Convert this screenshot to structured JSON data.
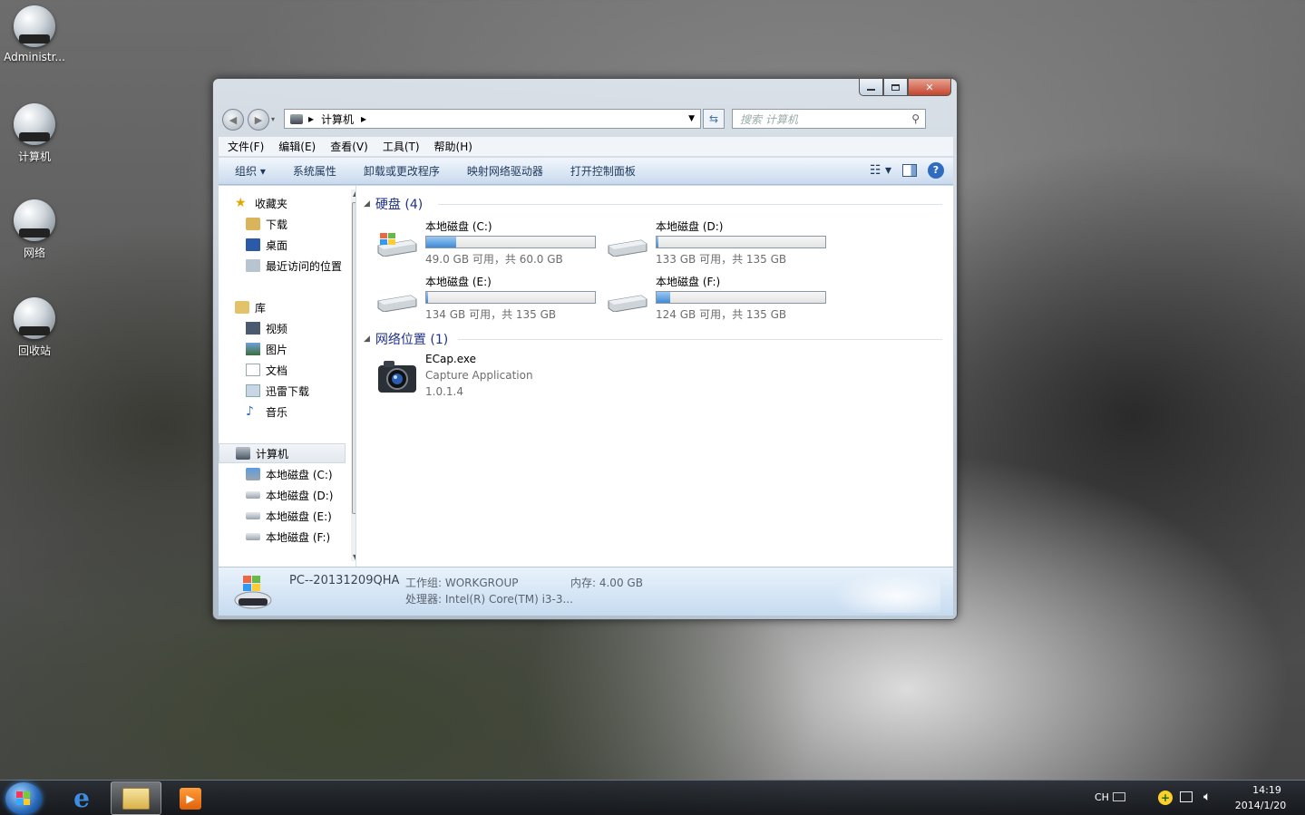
{
  "desktop": {
    "icons": [
      {
        "label": "Administr..."
      },
      {
        "label": "计算机"
      },
      {
        "label": "网络"
      },
      {
        "label": "回收站"
      }
    ]
  },
  "window": {
    "address": {
      "crumb": "计算机"
    },
    "search_placeholder": "搜索 计算机",
    "menu": [
      "文件(F)",
      "编辑(E)",
      "查看(V)",
      "工具(T)",
      "帮助(H)"
    ],
    "commands": [
      "组织 ▾",
      "系统属性",
      "卸载或更改程序",
      "映射网络驱动器",
      "打开控制面板"
    ],
    "nav": {
      "favorites": "收藏夹",
      "fav_items": [
        "下载",
        "桌面",
        "最近访问的位置"
      ],
      "libraries": "库",
      "lib_items": [
        "视频",
        "图片",
        "文档",
        "迅雷下载",
        "音乐"
      ],
      "computer": "计算机",
      "drives": [
        "本地磁盘 (C:)",
        "本地磁盘 (D:)",
        "本地磁盘 (E:)",
        "本地磁盘 (F:)"
      ]
    },
    "groups": {
      "hdd": "硬盘 (4)",
      "network": "网络位置 (1)"
    },
    "drives": [
      {
        "name": "本地磁盘 (C:)",
        "free": "49.0 GB 可用，共 60.0 GB",
        "used_fraction": 0.18
      },
      {
        "name": "本地磁盘 (D:)",
        "free": "133 GB 可用，共 135 GB",
        "used_fraction": 0.01
      },
      {
        "name": "本地磁盘 (E:)",
        "free": "134 GB 可用，共 135 GB",
        "used_fraction": 0.01
      },
      {
        "name": "本地磁盘 (F:)",
        "free": "124 GB 可用，共 135 GB",
        "used_fraction": 0.08
      }
    ],
    "network_item": {
      "name": "ECap.exe",
      "desc": "Capture Application",
      "version": "1.0.1.4"
    },
    "details": {
      "pc": "PC--20131209QHA",
      "workgroup": "工作组: WORKGROUP",
      "memory": "内存: 4.00 GB",
      "cpu": "处理器: Intel(R) Core(TM) i3-3..."
    }
  },
  "taskbar": {
    "lang": "CH",
    "time": "14:19",
    "date": "2014/1/20"
  }
}
